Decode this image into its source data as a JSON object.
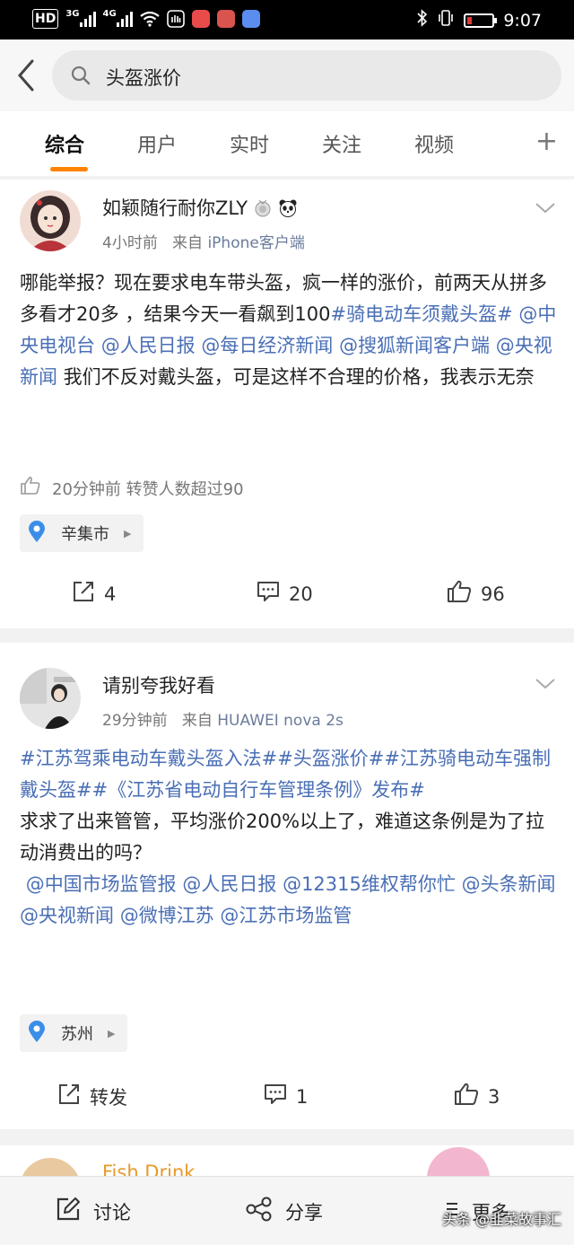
{
  "status_bar": {
    "network_label": "HD",
    "net1": "3G",
    "net2": "4G",
    "time": "9:07"
  },
  "search": {
    "query": "头盔涨价"
  },
  "tabs": [
    {
      "label": "综合",
      "active": true
    },
    {
      "label": "用户"
    },
    {
      "label": "实时"
    },
    {
      "label": "关注"
    },
    {
      "label": "视频"
    }
  ],
  "posts": [
    {
      "username": "如颖随行耐你ZLY",
      "time": "4小时前",
      "from_prefix": "来自",
      "source": "iPhone客户端",
      "text_segments": [
        {
          "t": "哪能举报？现在要求电车带头盔，疯一样的涨价，前两天从拼多多看才20多 ，结果今天一看飙到100"
        },
        {
          "t": "#骑电动车须戴头盔#",
          "link": true
        },
        {
          "t": " "
        },
        {
          "t": "@中央电视台",
          "link": true
        },
        {
          "t": " "
        },
        {
          "t": "@人民日报",
          "link": true
        },
        {
          "t": " "
        },
        {
          "t": "@每日经济新闻",
          "link": true
        },
        {
          "t": " "
        },
        {
          "t": "@搜狐新闻客户端",
          "link": true
        },
        {
          "t": " "
        },
        {
          "t": "@央视新闻",
          "link": true
        },
        {
          "t": " 我们不反对戴头盔，可是这样不合理的价格，我表示无奈"
        }
      ],
      "likes_line": "20分钟前 转赞人数超过90",
      "location": "辛集市",
      "repost_count": "4",
      "comment_count": "20",
      "like_count": "96"
    },
    {
      "username": "请别夸我好看",
      "time": "29分钟前",
      "from_prefix": "来自",
      "source": "HUAWEI nova 2s",
      "text_segments": [
        {
          "t": "#江苏驾乘电动车戴头盔入法##头盔涨价##江苏骑电动车强制戴头盔##《江苏省电动自行车管理条例》发布#",
          "link": true
        },
        {
          "t": "\n求求了出来管管，平均涨价200%以上了，难道这条例是为了拉动消费出的吗？\n "
        },
        {
          "t": "@中国市场监管报",
          "link": true
        },
        {
          "t": " "
        },
        {
          "t": "@人民日报",
          "link": true
        },
        {
          "t": " "
        },
        {
          "t": "@12315维权帮你忙",
          "link": true
        },
        {
          "t": " "
        },
        {
          "t": "@头条新闻",
          "link": true
        },
        {
          "t": " "
        },
        {
          "t": "@央视新闻",
          "link": true
        },
        {
          "t": " "
        },
        {
          "t": "@微博江苏",
          "link": true
        },
        {
          "t": " "
        },
        {
          "t": "@江苏市场监管",
          "link": true
        }
      ],
      "location": "苏州",
      "repost_label": "转发",
      "comment_count": "1",
      "like_count": "3"
    }
  ],
  "partial_username": "Fish Drink",
  "bottom_bar": {
    "comment_label": "讨论",
    "share_label": "分享",
    "more_label": "更多"
  },
  "watermark": "头条 @韭菜故事汇",
  "colors": {
    "accent": "#ff8200",
    "link": "#4a6fb5"
  }
}
